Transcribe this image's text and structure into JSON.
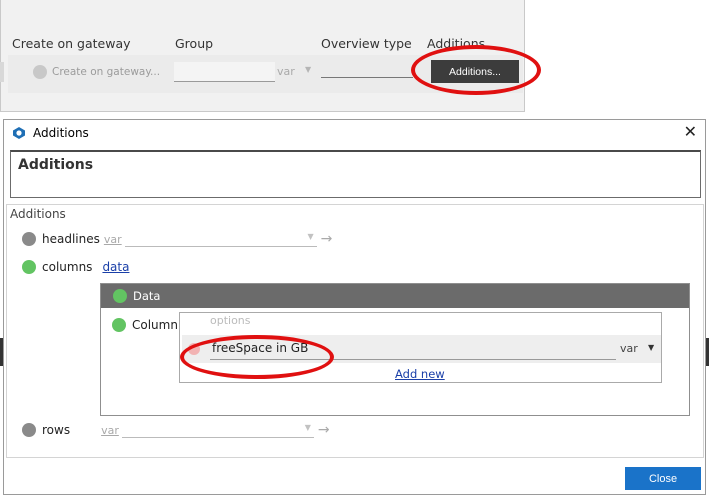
{
  "background_window": {
    "columns": {
      "create_on_gateway": "Create on gateway",
      "group": "Group",
      "overview_type": "Overview type",
      "additions": "Additions"
    },
    "gateway_placeholder": "Create on gateway...",
    "group_var": "var",
    "additions_button": "Additions..."
  },
  "dialog": {
    "title": "Additions",
    "close_glyph": "✕",
    "header_title": "Additions",
    "section_label": "Additions",
    "rows": {
      "headlines": {
        "label": "headlines",
        "var": "var"
      },
      "columns": {
        "label": "columns",
        "link": "data"
      },
      "rows": {
        "label": "rows",
        "var": "var"
      }
    },
    "data_panel": {
      "title": "Data",
      "column_label": "Column",
      "options_label": "options",
      "option_value": "freeSpace in GB",
      "option_var": "var",
      "add_new": "Add new"
    },
    "close_button": "Close"
  },
  "colors": {
    "active_green": "#62c462",
    "inactive_gray": "#8a8a8a",
    "primary_button": "#1a73c9",
    "highlight_red": "#e01010"
  }
}
